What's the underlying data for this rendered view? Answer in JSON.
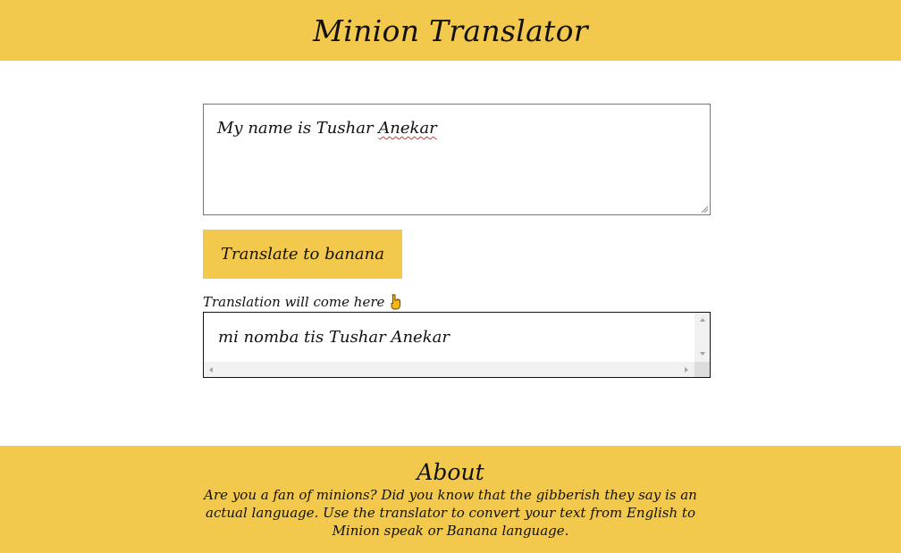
{
  "header": {
    "title": "Minion Translator"
  },
  "input": {
    "value_before": "My name is Tushar ",
    "value_misspelled": "Anekar"
  },
  "translate_button": {
    "label": "Translate to banana"
  },
  "output": {
    "label": "Translation will come here",
    "label_icon": "pointing-down-hand-icon",
    "value": "mi nomba tis Tushar Anekar"
  },
  "footer": {
    "title": "About",
    "description": "Are you a fan of minions? Did you know that the gibberish they say is an actual language. Use the translator to convert your text from English to Minion speak or Banana language."
  },
  "colors": {
    "accent": "#f2c94c",
    "text": "#111111",
    "border": "#767676"
  }
}
